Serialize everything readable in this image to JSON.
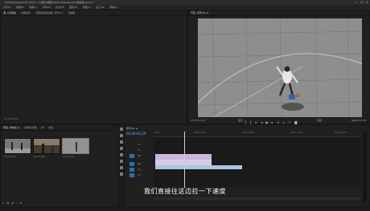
{
  "window": {
    "title": "Adobe Premiere Pro 2020 - C:\\用户\\视频\\Adobe Premiere Pro\\未命名.prproj *",
    "controls": [
      "—",
      "☐",
      "✕"
    ]
  },
  "menu": [
    "文件(F)",
    "编辑(E)",
    "剪辑(C)",
    "序列(S)",
    "标记(M)",
    "图形(G)",
    "视图(V)",
    "窗口(W)",
    "帮助(H)"
  ],
  "source_panel": {
    "tabs": [
      "源: (无剪辑)",
      "效果控件",
      "音频剪辑混合器: 序列 01",
      "元数据"
    ],
    "footer_timecode": "00;00;00;00"
  },
  "program_panel": {
    "tabs": [
      "节目: 序列 01 ≡"
    ],
    "timecode_left": "00;00;04;29",
    "fit_label": "适合",
    "quality_label": "完整",
    "timecode_right": "00;00;17;15",
    "transport_icons": [
      "mark-in-icon",
      "mark-out-icon",
      "go-to-in-icon",
      "step-back-icon",
      "play-icon",
      "step-forward-icon",
      "go-to-out-icon",
      "lift-icon",
      "extract-icon",
      "export-frame-icon"
    ]
  },
  "project_panel": {
    "tabs": [
      "项目: 未命名 ≡",
      "媒体浏览器",
      "库",
      "信息"
    ],
    "thumbnails": [
      {
        "label": "clip_01.mp4",
        "selected": false,
        "bg": "#707070"
      },
      {
        "label": "clip_02.mp4",
        "selected": false,
        "bg": "#5a4a3a"
      },
      {
        "label": "clip_03.mp4",
        "selected": true,
        "bg": "#8a8a8a"
      }
    ]
  },
  "timeline_panel": {
    "sequence_tab": "序列 01 ≡",
    "timecode": "00;00;04;29",
    "ruler_marks": [
      "00;00",
      "00;00;04;00",
      "00;00;08;00",
      "00;00;12;00",
      "00;00;16;00"
    ],
    "tracks": [
      "V3",
      "V2",
      "V1",
      "A1",
      "A2",
      "A3"
    ],
    "clip_colors": {
      "video": "#b9a3cf",
      "video_selected": "#d4c4e3",
      "audio": "#8fb8da"
    }
  },
  "subtitle": "我们直接往这边拉一下速度"
}
